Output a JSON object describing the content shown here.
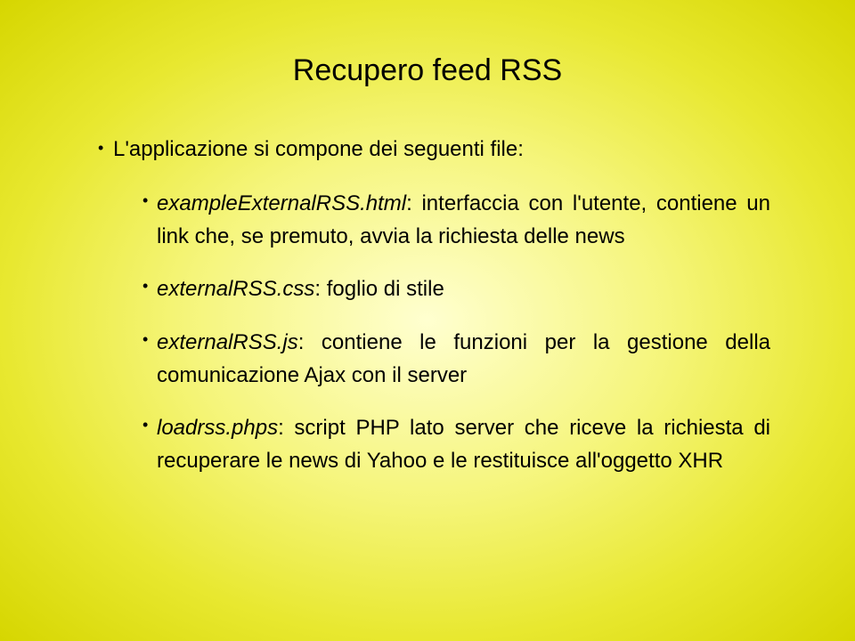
{
  "title": "Recupero feed RSS",
  "intro": "L'applicazione si compone dei seguenti file:",
  "items": [
    {
      "file": "exampleExternalRSS.html",
      "desc": ": interfaccia con l'utente, contiene un link che, se premuto, avvia la richiesta delle news"
    },
    {
      "file": "externalRSS.css",
      "desc": ": foglio di stile"
    },
    {
      "file": "externalRSS.js",
      "desc": ": contiene le funzioni per la gestione della comunicazione Ajax con il server"
    },
    {
      "file": "loadrss.phps",
      "desc": ": script PHP lato server che riceve la richiesta di recuperare le news di Yahoo e le restituisce all'oggetto XHR"
    }
  ]
}
